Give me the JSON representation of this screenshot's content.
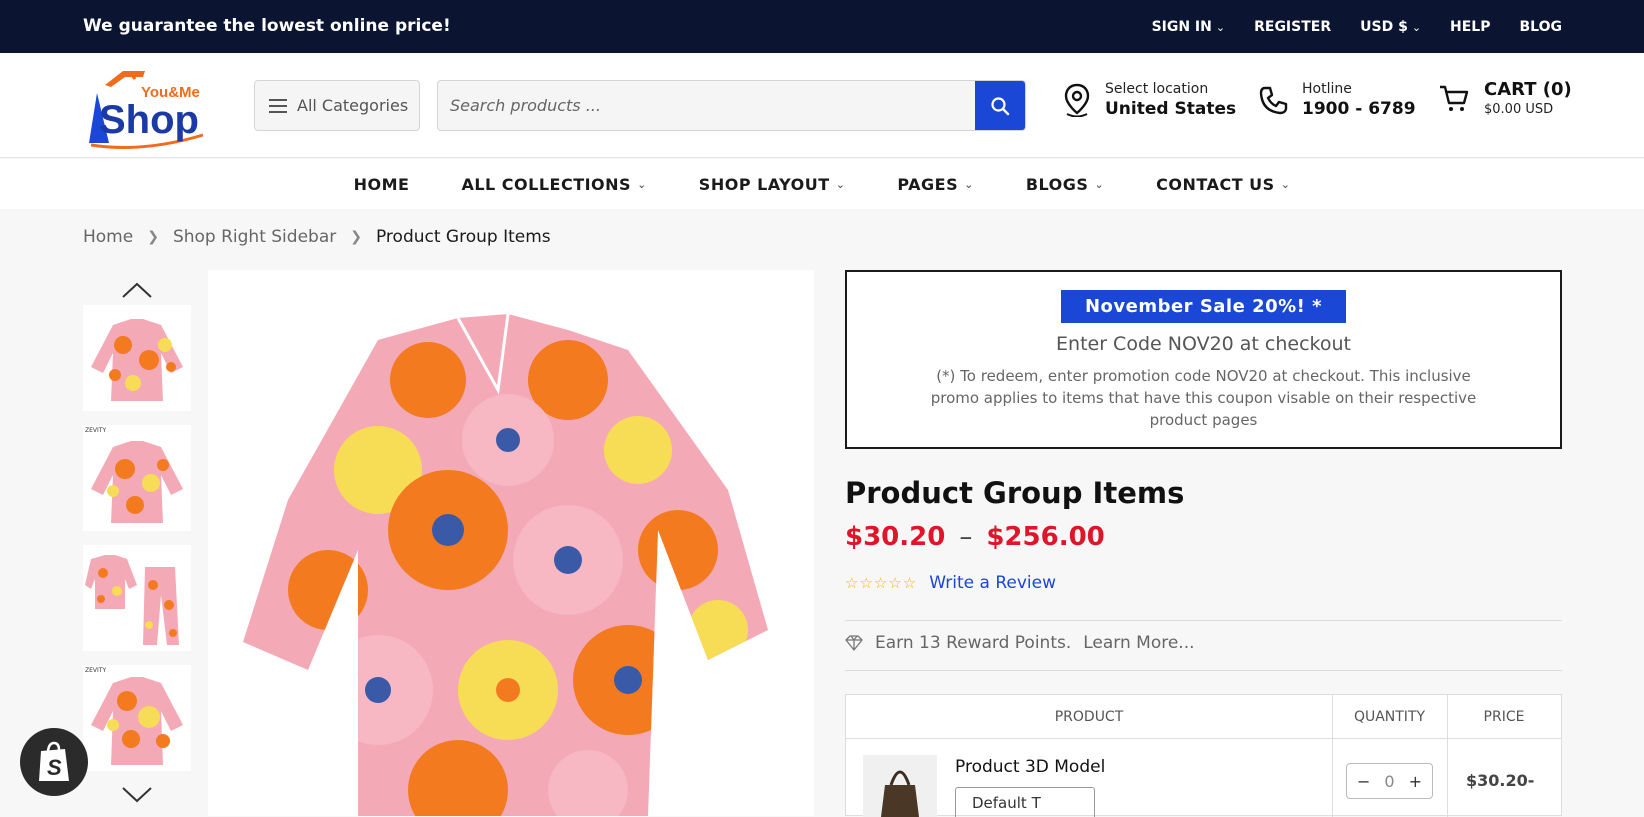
{
  "topbar": {
    "promo": "We guarantee the lowest online price!",
    "links": [
      {
        "label": "SIGN IN",
        "chevron": true
      },
      {
        "label": "REGISTER",
        "chevron": false
      },
      {
        "label": "USD $",
        "chevron": true
      },
      {
        "label": "HELP",
        "chevron": false
      },
      {
        "label": "BLOG",
        "chevron": false
      }
    ]
  },
  "header": {
    "logo_top": "You&Me",
    "logo_main": "Shop",
    "all_categories": "All Categories",
    "search_placeholder": "Search products ...",
    "location_label": "Select location",
    "location_value": "United States",
    "hotline_label": "Hotline",
    "hotline_value": "1900 - 6789",
    "cart_label": "CART (0)",
    "cart_total": "$0.00 USD"
  },
  "nav": {
    "items": [
      {
        "label": "HOME",
        "chevron": false
      },
      {
        "label": "ALL COLLECTIONS",
        "chevron": true
      },
      {
        "label": "SHOP LAYOUT",
        "chevron": true
      },
      {
        "label": "PAGES",
        "chevron": true
      },
      {
        "label": "BLOGS",
        "chevron": true
      },
      {
        "label": "CONTACT US",
        "chevron": true
      }
    ]
  },
  "breadcrumb": [
    "Home",
    "Shop Right Sidebar",
    "Product Group Items"
  ],
  "thumbnails": [
    {
      "label": ""
    },
    {
      "label": "ZEVITY"
    },
    {
      "label": ""
    },
    {
      "label": "ZEVITY"
    }
  ],
  "promo_box": {
    "badge": "November Sale 20%! *",
    "code": "Enter Code NOV20 at checkout",
    "desc": "(*) To redeem, enter promotion code NOV20 at checkout. This inclusive promo applies to items that have this coupon visable on their respective product pages"
  },
  "product": {
    "title": "Product Group Items",
    "price_low": "$30.20",
    "price_high": "$256.00",
    "price_sep": "–",
    "stars": "☆☆☆☆☆",
    "review_link": "Write a Review",
    "reward": "Earn 13 Reward Points.",
    "reward_link": "Learn More..."
  },
  "table": {
    "headers": [
      "PRODUCT",
      "QUANTITY",
      "PRICE"
    ],
    "row": {
      "name": "Product 3D Model",
      "variant": "Default T",
      "qty": "0",
      "minus": "−",
      "plus": "+",
      "price": "$30.20-"
    }
  },
  "colors": {
    "topbar_bg": "#0b1430",
    "accent_blue": "#1b47d6",
    "price_red": "#e0152a",
    "logo_orange": "#f26b1d"
  }
}
